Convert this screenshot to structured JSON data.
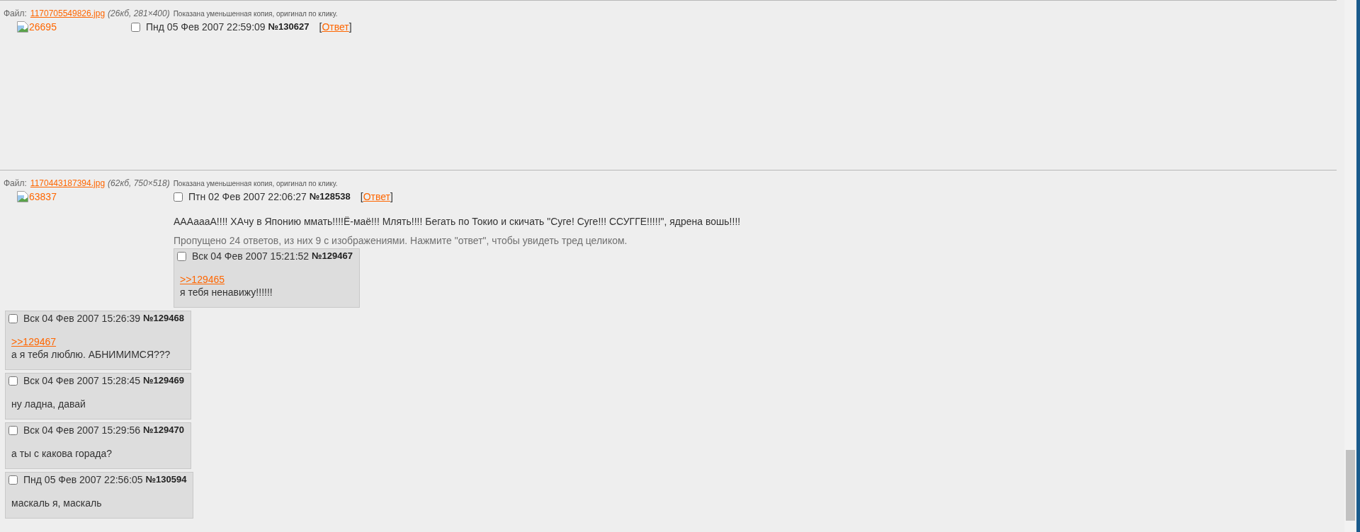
{
  "threads": [
    {
      "file": {
        "label": "Файл:",
        "name": "1170705549826.jpg",
        "info": "(26кб, 281×400)",
        "note": "Показана уменьшенная копия, оригинал по клику."
      },
      "thumbnail": {
        "kind": "portrait",
        "alt": "26695"
      },
      "op": {
        "checked": false,
        "date": "Пнд 05 Фев 2007 22:59:09",
        "number": "№130627",
        "reply_link": {
          "open": "[",
          "label": "Ответ",
          "close": "]"
        }
      }
    },
    {
      "file": {
        "label": "Файл:",
        "name": "1170443187394.jpg",
        "info": "(62кб, 750×518)",
        "note": "Показана уменьшенная копия, оригинал по клику."
      },
      "thumbnail": {
        "kind": "landscape",
        "alt": "63837"
      },
      "op": {
        "checked": false,
        "date": "Птн 02 Фев 2007 22:06:27",
        "number": "№128538",
        "reply_link": {
          "open": "[",
          "label": "Ответ",
          "close": "]"
        },
        "message": "АААаааА!!!! ХАчу в Японию ммать!!!!Ё-маё!!! Млять!!!! Бегать по Токио и скичать \"Суге! Суге!!! ССУГГЕ!!!!!\", ядрена вошь!!!!"
      },
      "omitted": "Пропущено 24 ответов, из них 9 с изображениями. Нажмите \"ответ\", чтобы увидеть тред целиком.",
      "replies": [
        {
          "checked": false,
          "date": "Вск 04 Фев 2007 15:21:52",
          "number": "№129467",
          "quote": ">>129465",
          "message": "я тебя ненавижу!!!!!!"
        },
        {
          "checked": false,
          "date": "Вск 04 Фев 2007 15:26:39",
          "number": "№129468",
          "quote": ">>129467",
          "message": "а я тебя люблю. АБНИМИМСЯ???"
        },
        {
          "checked": false,
          "date": "Вск 04 Фев 2007 15:28:45",
          "number": "№129469",
          "message": "ну ладна, давай"
        },
        {
          "checked": false,
          "date": "Вск 04 Фев 2007 15:29:56",
          "number": "№129470",
          "message": "а ты с какова горада?"
        },
        {
          "checked": false,
          "date": "Пнд 05 Фев 2007 22:56:05",
          "number": "№130594",
          "message": "маскаль я, маскаль"
        }
      ]
    }
  ]
}
